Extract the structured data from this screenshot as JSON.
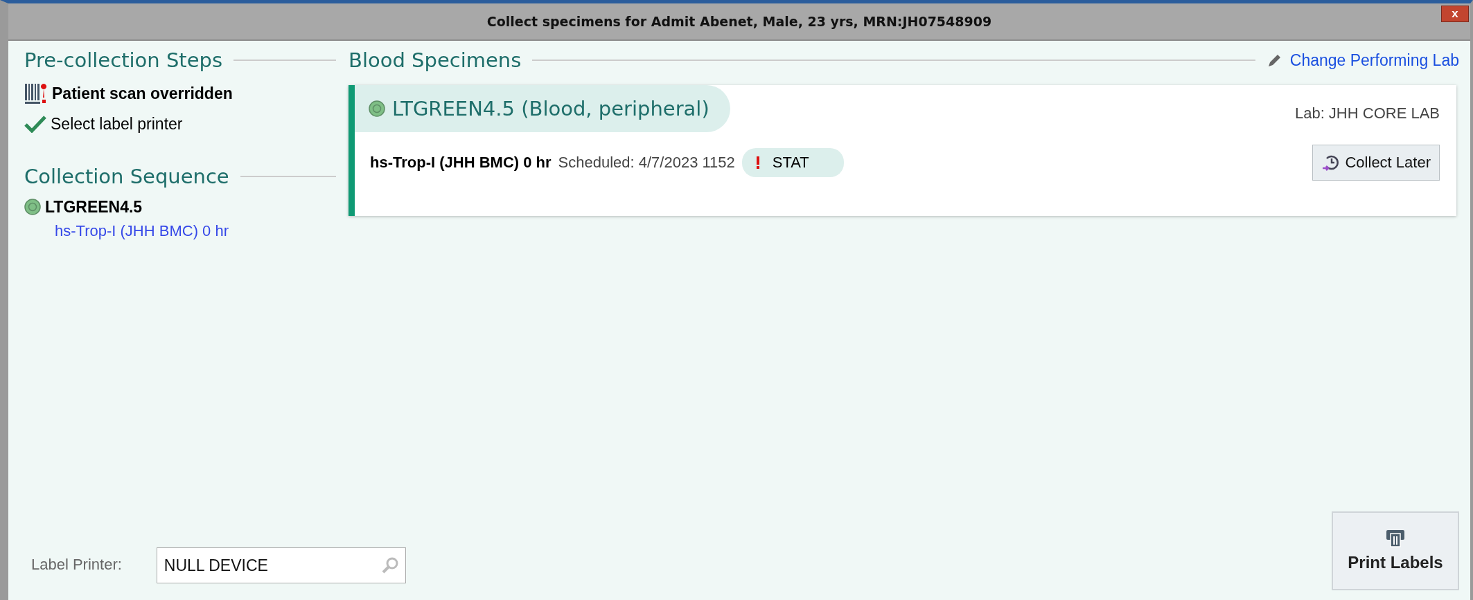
{
  "window": {
    "title": "Collect specimens for Admit Abenet, Male, 23 yrs,  MRN:JH07548909",
    "close": "x"
  },
  "pre_collection": {
    "heading": "Pre-collection Steps",
    "steps": [
      {
        "kind": "overridden",
        "label": "Patient scan overridden"
      },
      {
        "kind": "done",
        "label": "Select label printer"
      }
    ]
  },
  "collection_sequence": {
    "heading": "Collection Sequence",
    "containers": [
      {
        "name": "LTGREEN4.5",
        "tests": [
          "hs-Trop-I (JHH BMC) 0 hr"
        ]
      }
    ]
  },
  "specimens": {
    "heading": "Blood Specimens",
    "change_lab": {
      "label": "Change Performing Lab"
    },
    "cards": [
      {
        "title": "LTGREEN4.5 (Blood, peripheral)",
        "lab": "Lab: JHH CORE LAB",
        "orders": [
          {
            "test": "hs-Trop-I (JHH BMC) 0 hr",
            "scheduled": "Scheduled: 4/7/2023 1152",
            "priority": "STAT",
            "button": "Collect Later"
          }
        ]
      }
    ]
  },
  "footer": {
    "printer_label": "Label Printer:",
    "printer_value": "NULL DEVICE",
    "print_button": {
      "label": "Print Labels"
    }
  }
}
